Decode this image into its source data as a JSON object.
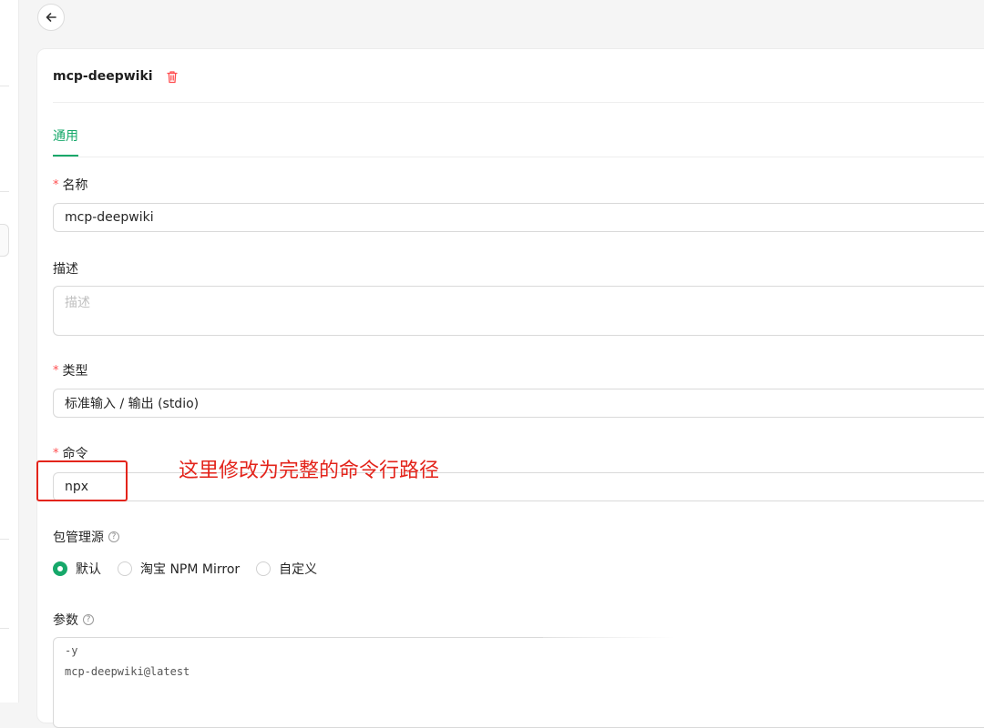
{
  "server": {
    "title": "mcp-deepwiki"
  },
  "tabs": [
    {
      "label": "通用",
      "active": true
    }
  ],
  "form": {
    "name": {
      "label": "名称",
      "required": true,
      "value": "mcp-deepwiki"
    },
    "description": {
      "label": "描述",
      "required": false,
      "placeholder": "描述"
    },
    "type": {
      "label": "类型",
      "required": true,
      "value": "标准输入 / 输出 (stdio)"
    },
    "command": {
      "label": "命令",
      "required": true,
      "value": "npx"
    },
    "registry": {
      "label": "包管理源",
      "options": [
        {
          "label": "默认",
          "selected": true
        },
        {
          "label": "淘宝 NPM Mirror",
          "selected": false
        },
        {
          "label": "自定义",
          "selected": false
        }
      ]
    },
    "args": {
      "label": "参数",
      "lines": [
        "-y",
        "mcp-deepwiki@latest"
      ]
    }
  },
  "annotation": {
    "text": "这里修改为完整的命令行路径"
  },
  "icons": {
    "back": "arrow-left-icon",
    "delete": "trash-icon",
    "help": "question-circle-icon"
  },
  "colors": {
    "accent": "#16a86a",
    "danger": "#ff4d4f",
    "annotation": "#e3241b"
  }
}
